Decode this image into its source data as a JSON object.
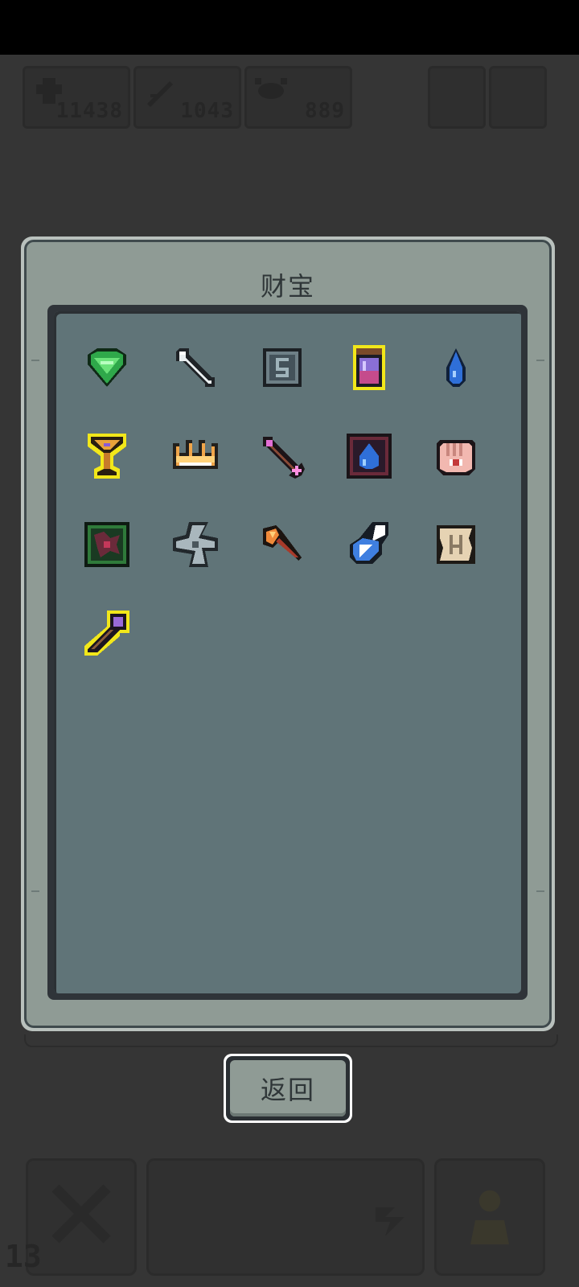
{
  "hud": {
    "counters": [
      {
        "icon": "attack-icon",
        "value": "11438"
      },
      {
        "icon": "sword-icon",
        "value": "1043"
      },
      {
        "icon": "crab-icon",
        "value": "889"
      }
    ],
    "level": "13"
  },
  "dialog": {
    "title": "财宝",
    "items": [
      {
        "icon": "emerald-heart-gem-icon",
        "highlighted": false
      },
      {
        "icon": "bone-icon",
        "highlighted": false
      },
      {
        "icon": "stone-rune-tablet-icon",
        "highlighted": false
      },
      {
        "icon": "purple-potion-jar-icon",
        "highlighted": true
      },
      {
        "icon": "blue-water-drop-icon",
        "highlighted": false
      },
      {
        "icon": "golden-chalice-icon",
        "highlighted": true
      },
      {
        "icon": "golden-crown-claw-icon",
        "highlighted": false
      },
      {
        "icon": "pink-arrow-icon",
        "highlighted": false
      },
      {
        "icon": "water-drop-tome-icon",
        "highlighted": false
      },
      {
        "icon": "eye-palm-hand-icon",
        "highlighted": false
      },
      {
        "icon": "green-vine-tome-icon",
        "highlighted": false
      },
      {
        "icon": "steel-shuriken-icon",
        "highlighted": false
      },
      {
        "icon": "fire-axe-icon",
        "highlighted": false
      },
      {
        "icon": "winged-blue-charm-icon",
        "highlighted": false
      },
      {
        "icon": "ancient-map-scroll-icon",
        "highlighted": false
      },
      {
        "icon": "purple-hammer-icon",
        "highlighted": true
      }
    ],
    "back_label": "返回"
  },
  "colors": {
    "background": "#353535",
    "panel": "#8f9b95",
    "panel_inner": "#607478",
    "highlight": "#f2e71a"
  }
}
